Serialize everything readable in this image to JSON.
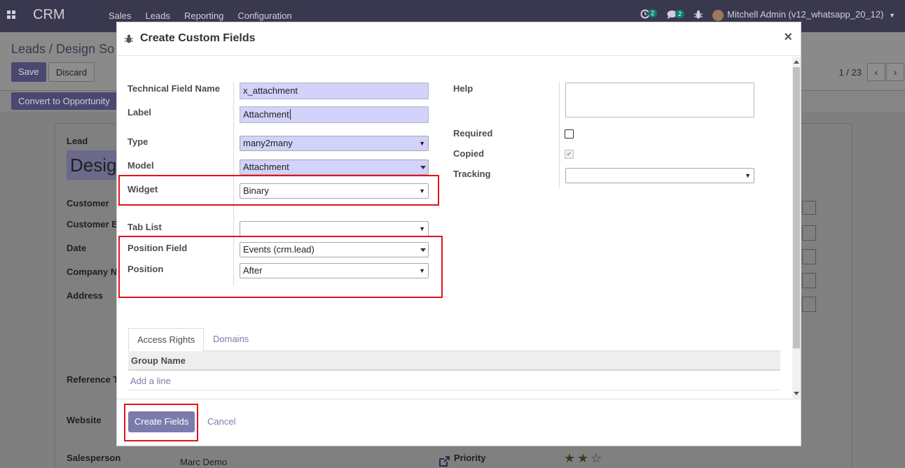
{
  "app": {
    "brand": "CRM",
    "menu": [
      "Sales",
      "Leads",
      "Reporting",
      "Configuration"
    ],
    "activity_count": "2",
    "message_count": "2",
    "user": "Mitchell Admin (v12_whatsapp_20_12)"
  },
  "control_panel": {
    "breadcrumb": "Leads / Design So",
    "save_label": "Save",
    "discard_label": "Discard",
    "pager": "1 / 23",
    "convert_label": "Convert to Opportunity"
  },
  "sheet": {
    "lead_label": "Lead",
    "lead_name": "Desig",
    "labels": [
      "Customer",
      "Customer E",
      "Date",
      "Company N",
      "Address",
      "Reference T",
      "Website",
      "Salesperson"
    ],
    "salesperson_value": "Marc Demo",
    "priority_label": "Priority",
    "priority_stars": "★★☆"
  },
  "dialog": {
    "title": "Create Custom Fields",
    "close_glyph": "×",
    "left": {
      "technical_name_label": "Technical Field Name",
      "technical_name_value": "x_attachment",
      "label_label": "Label",
      "label_value": "Attachment",
      "type_label": "Type",
      "type_value": "many2many",
      "model_label": "Model",
      "model_value": "Attachment",
      "widget_label": "Widget",
      "widget_value": "Binary",
      "tab_list_label": "Tab List",
      "tab_list_value": "",
      "position_field_label": "Position Field",
      "position_field_value": "Events (crm.lead)",
      "position_label": "Position",
      "position_value": "After"
    },
    "right": {
      "help_label": "Help",
      "required_label": "Required",
      "copied_label": "Copied",
      "tracking_label": "Tracking",
      "tracking_value": ""
    },
    "tabs": [
      "Access Rights",
      "Domains"
    ],
    "table": {
      "header": "Group Name",
      "add_line": "Add a line"
    },
    "footer": {
      "create_label": "Create Fields",
      "cancel_label": "Cancel"
    },
    "arrow_glyph": "▼",
    "check_glyph": "✔"
  },
  "colors": {
    "navbar": "#3a384f",
    "primary": "#7c7bad",
    "required_field": "#d2d2fa",
    "highlight": "#e0141a"
  }
}
